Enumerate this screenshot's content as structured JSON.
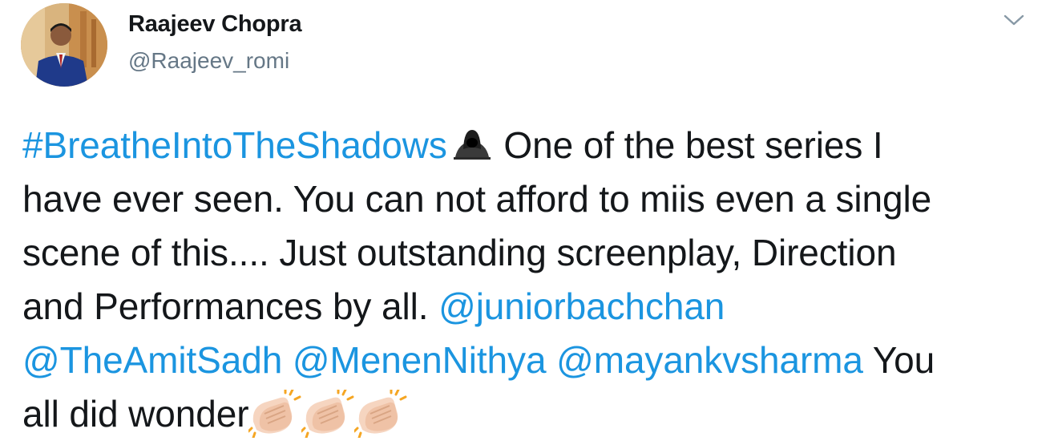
{
  "user": {
    "display_name": "Raajeev Chopra",
    "handle": "@Raajeev_romi"
  },
  "tweet": {
    "hashtag": "#BreatheIntoTheShadows",
    "line1_rest": " One of the best series I",
    "line2": "have ever seen. You can not afford to miis even a single",
    "line3": "scene of this.... Just outstanding screenplay, Direction",
    "line4_text": "and Performances by all. ",
    "mention1": "@juniorbachchan",
    "mention2": "@TheAmitSadh",
    "mention3": "@MenenNithya",
    "mention4": "@mayankvsharma",
    "line5_rest": " You",
    "line6": "all did wonder",
    "emojis": [
      "hooded-figure-icon",
      "clapping-hands-icon",
      "clapping-hands-icon",
      "clapping-hands-icon"
    ]
  },
  "colors": {
    "link": "#1b95e0",
    "text": "#14171a",
    "handle": "#657786"
  }
}
